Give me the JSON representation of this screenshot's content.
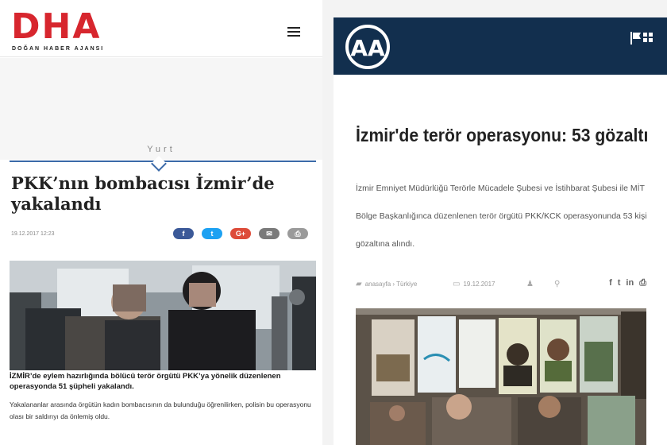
{
  "dha": {
    "logo": "DHA",
    "tagline": "DOĞAN HABER AJANSI",
    "menu_icon": "hamburger-menu-icon",
    "section": "Yurt",
    "title": "PKK’nın bombacısı İzmir’de yakalandı",
    "date": "19.12.2017 12:23",
    "share": [
      {
        "name": "facebook",
        "glyph": "f",
        "color": "#3b5998"
      },
      {
        "name": "twitter",
        "glyph": "t",
        "color": "#1da1f2"
      },
      {
        "name": "google-plus",
        "glyph": "G+",
        "color": "#dd4b39"
      },
      {
        "name": "email",
        "glyph": "✉",
        "color": "#7a7a7a"
      },
      {
        "name": "print",
        "glyph": "⎙",
        "color": "#9a9a9a"
      }
    ],
    "caption": "İZMİR’de eylem hazırlığında bölücü terör örgütü PKK’ya yönelik düzenlenen operasyonda 51 şüpheli yakalandı.",
    "body": "Yakalananlar arasında örgütün kadın bombacısının da bulunduğu öğrenilirken, polisin bu operasyonu olası bir saldırıyı da önlemiş oldu."
  },
  "aa": {
    "logo": "AA",
    "flag_icon": "language-flag-icon",
    "title": "İzmir'de terör operasyonu: 53 gözaltı",
    "lead": "İzmir Emniyet Müdürlüğü Terörle Mücadele Şubesi ve İstihbarat Şubesi ile MİT Bölge Başkanlığınca düzenlenen terör örgütü PKK/KCK operasyonunda 53 kişi gözaltına alındı.",
    "breadcrumb": "anasayfa › Türkiye",
    "date": "19.12.2017",
    "tools": [
      {
        "name": "facebook",
        "glyph": "f"
      },
      {
        "name": "twitter",
        "glyph": "t"
      },
      {
        "name": "linkedin",
        "glyph": "in"
      },
      {
        "name": "print",
        "glyph": "⎙"
      }
    ]
  },
  "colors": {
    "dha_red": "#d7262e",
    "dha_rule": "#3b6aa8",
    "aa_navy": "#122f4e"
  }
}
